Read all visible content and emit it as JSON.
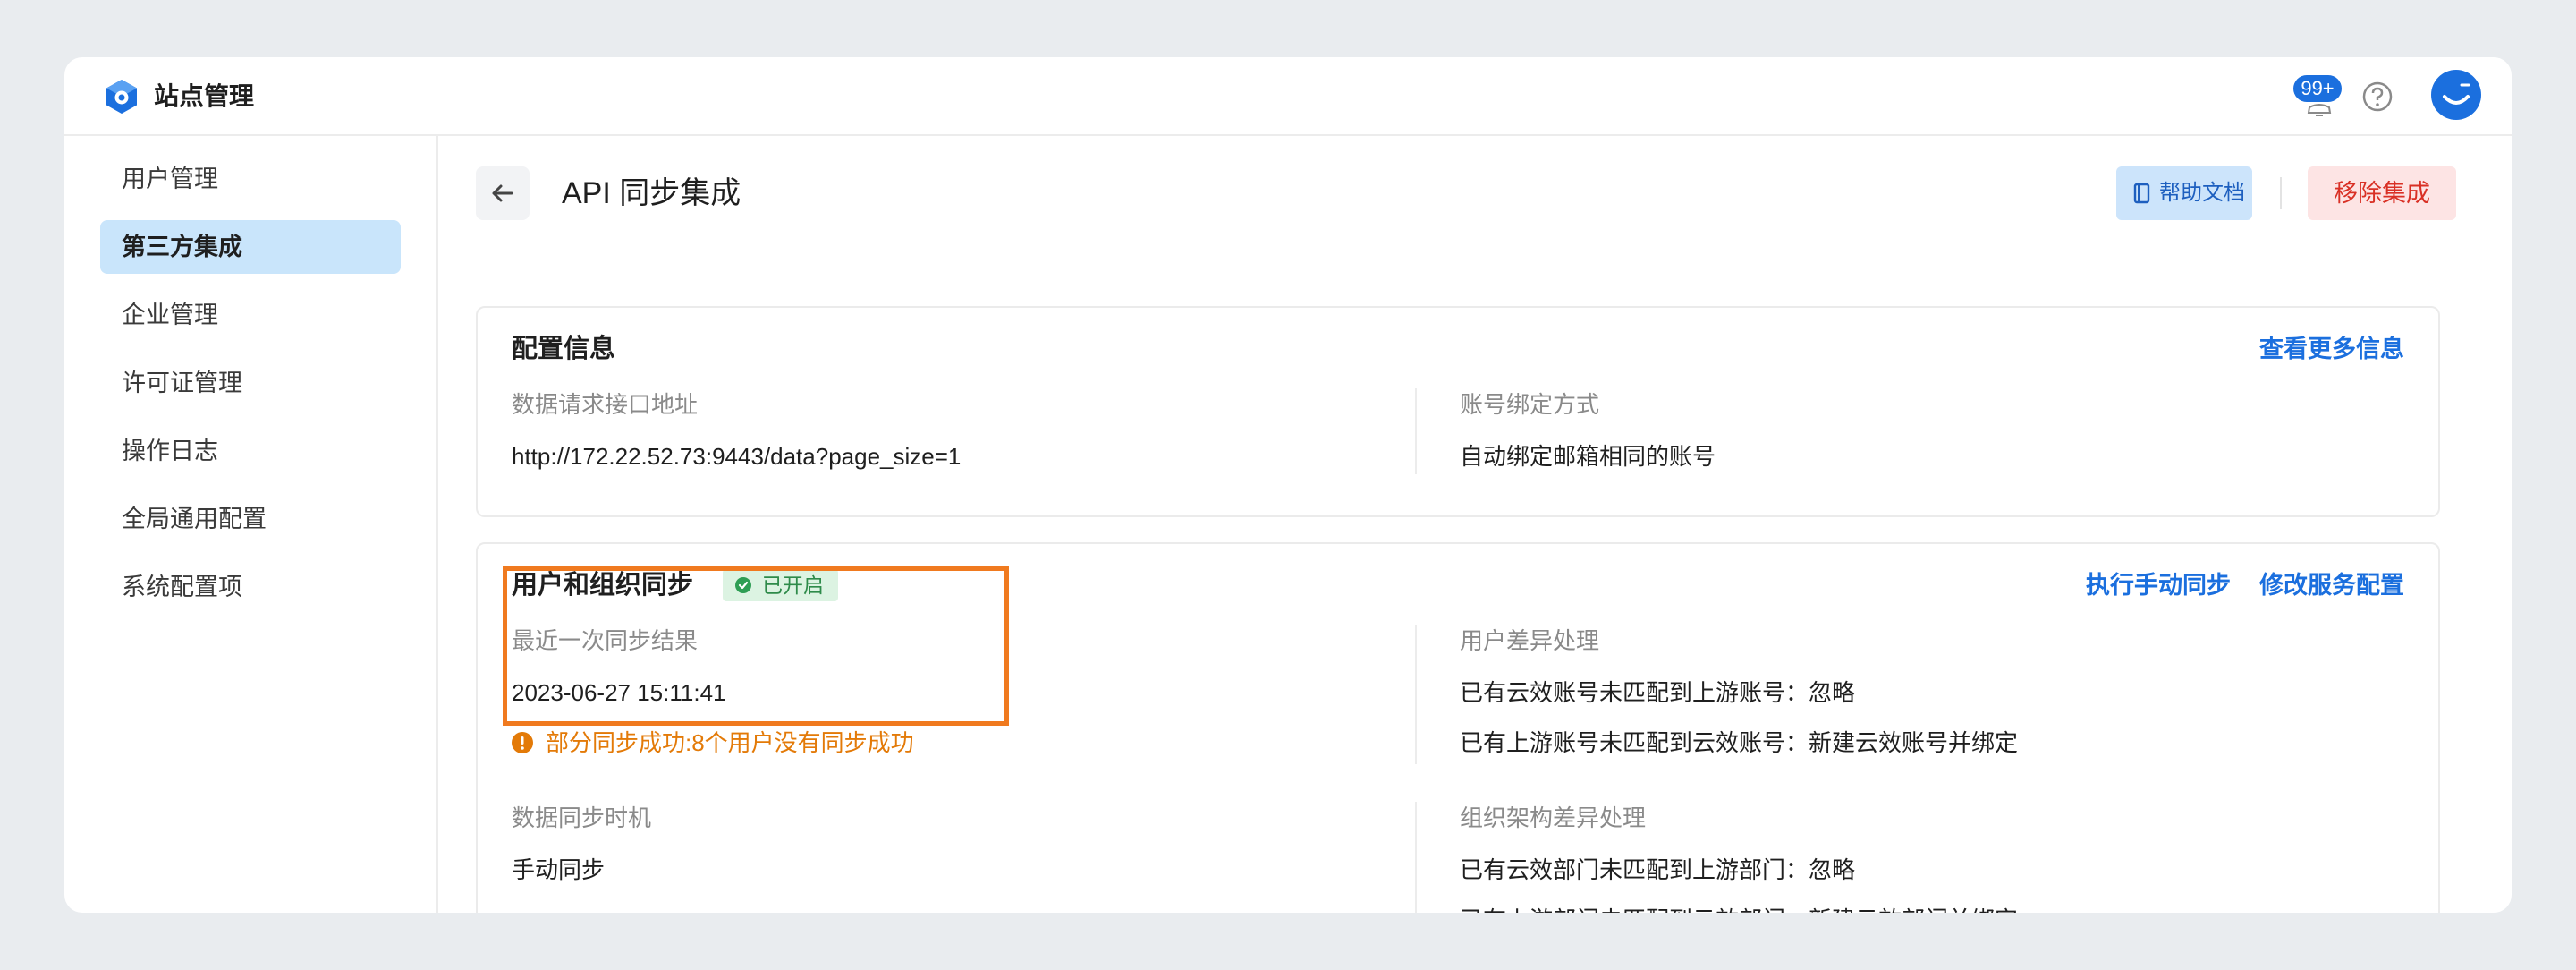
{
  "header": {
    "app_title": "站点管理",
    "notification_count": "99+"
  },
  "sidebar": {
    "items": [
      {
        "label": "用户管理"
      },
      {
        "label": "第三方集成"
      },
      {
        "label": "企业管理"
      },
      {
        "label": "许可证管理"
      },
      {
        "label": "操作日志"
      },
      {
        "label": "全局通用配置"
      },
      {
        "label": "系统配置项"
      }
    ],
    "active_index": 1
  },
  "page": {
    "title": "API 同步集成",
    "help_doc_label": "帮助文档",
    "remove_label": "移除集成"
  },
  "config_card": {
    "title": "配置信息",
    "more_link": "查看更多信息",
    "api_url_label": "数据请求接口地址",
    "api_url_value": "http://172.22.52.73:9443/data?page_size=1",
    "binding_label": "账号绑定方式",
    "binding_value": "自动绑定邮箱相同的账号"
  },
  "sync_card": {
    "title": "用户和组织同步",
    "status_badge": "已开启",
    "manual_sync_link": "执行手动同步",
    "edit_config_link": "修改服务配置",
    "last_result_label": "最近一次同步结果",
    "last_result_time": "2023-06-27 15:11:41",
    "last_result_message": "部分同步成功:8个用户没有同步成功",
    "timing_label": "数据同步时机",
    "timing_value": "手动同步",
    "user_diff_label": "用户差异处理",
    "user_diff_1": "已有云效账号未匹配到上游账号：忽略",
    "user_diff_2": "已有上游账号未匹配到云效账号：新建云效账号并绑定",
    "org_diff_label": "组织架构差异处理",
    "org_diff_1": "已有云效部门未匹配到上游部门：忽略",
    "org_diff_2": "已有上游部门未匹配到云效部门：新建云效部门并绑定"
  },
  "colors": {
    "accent": "#1b6fde",
    "danger": "#d93025",
    "success": "#2e8b4a",
    "warning": "#e37a08",
    "highlight": "#f07a1f"
  }
}
